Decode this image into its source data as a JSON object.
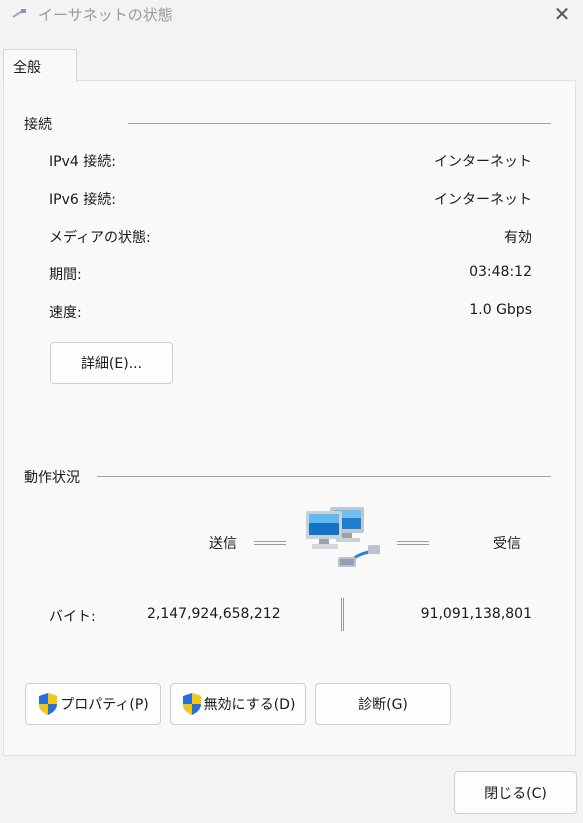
{
  "window": {
    "title": "イーサネットの状態",
    "close_symbol": "✕"
  },
  "tabs": [
    {
      "label": "全般"
    }
  ],
  "connection": {
    "group_title": "接続",
    "rows": [
      {
        "label": "IPv4 接続:",
        "value": "インターネット"
      },
      {
        "label": "IPv6 接続:",
        "value": "インターネット"
      },
      {
        "label": "メディアの状態:",
        "value": "有効"
      },
      {
        "label": "期間:",
        "value": "03:48:12"
      },
      {
        "label": "速度:",
        "value": "1.0 Gbps"
      }
    ],
    "details_button": "詳細(E)..."
  },
  "activity": {
    "group_title": "動作状況",
    "sent_label": "送信",
    "received_label": "受信",
    "bytes_label": "バイト:",
    "bytes_sent": "2,147,924,658,212",
    "bytes_received": "91,091,138,801"
  },
  "buttons": {
    "properties": "プロパティ(P)",
    "disable": "無効にする(D)",
    "diagnose": "診断(G)",
    "close": "閉じる(C)"
  },
  "icons": {
    "title": "network-cable-icon",
    "shield": "uac-shield-icon",
    "network": "network-computers-icon"
  },
  "colors": {
    "background": "#f3f3f3",
    "panel": "#f9f9f9",
    "shield_blue": "#2a6fd6",
    "shield_yellow": "#f5c518"
  }
}
